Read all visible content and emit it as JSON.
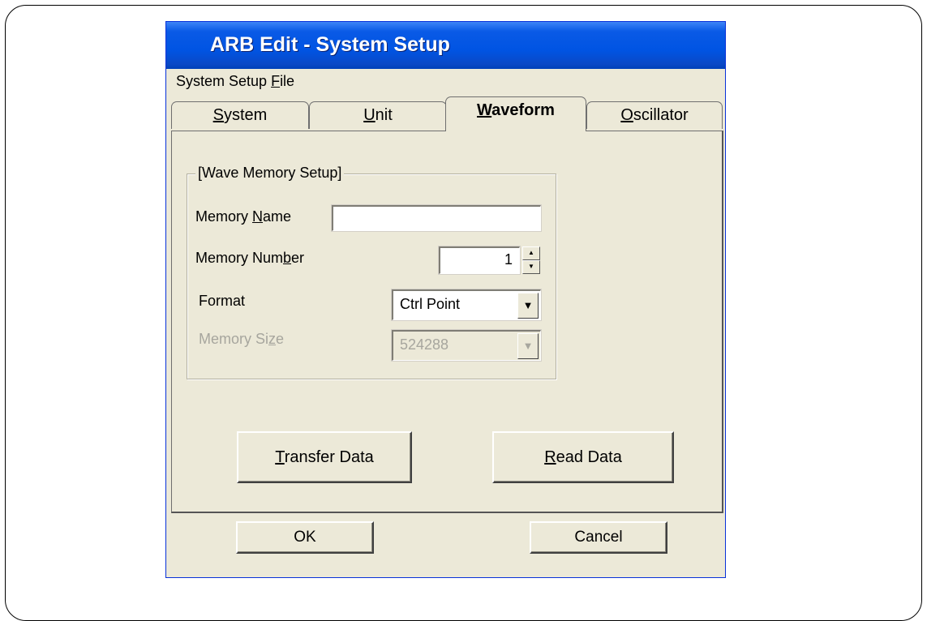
{
  "window": {
    "title": "ARB Edit - System Setup"
  },
  "menu": {
    "items": [
      {
        "pre": "System Setup ",
        "key": "F",
        "post": "ile"
      }
    ]
  },
  "tabs": [
    {
      "pre": "",
      "key": "S",
      "post": "ystem",
      "active": false
    },
    {
      "pre": "",
      "key": "U",
      "post": "nit",
      "active": false
    },
    {
      "pre": "",
      "key": "W",
      "post": "aveform",
      "active": true
    },
    {
      "pre": "",
      "key": "O",
      "post": "scillator",
      "active": false
    }
  ],
  "group": {
    "legend": "[Wave Memory Setup]",
    "memory_name": {
      "pre": "Memory ",
      "key": "N",
      "post": "ame",
      "value": ""
    },
    "memory_number": {
      "pre": "Memory Num",
      "key": "b",
      "post": "er",
      "value": "1"
    },
    "format": {
      "label": "Format",
      "value": "Ctrl Point",
      "arrow": "▼"
    },
    "memory_size": {
      "pre": "Memory Si",
      "key": "z",
      "post": "e",
      "value": "524288",
      "arrow": "▼",
      "enabled": false
    }
  },
  "spinner": {
    "up": "▲",
    "down": "▼"
  },
  "buttons": {
    "transfer": {
      "pre": "",
      "key": "T",
      "post": "ransfer Data"
    },
    "read": {
      "pre": "",
      "key": "R",
      "post": "ead Data"
    },
    "ok": "OK",
    "cancel": "Cancel"
  }
}
